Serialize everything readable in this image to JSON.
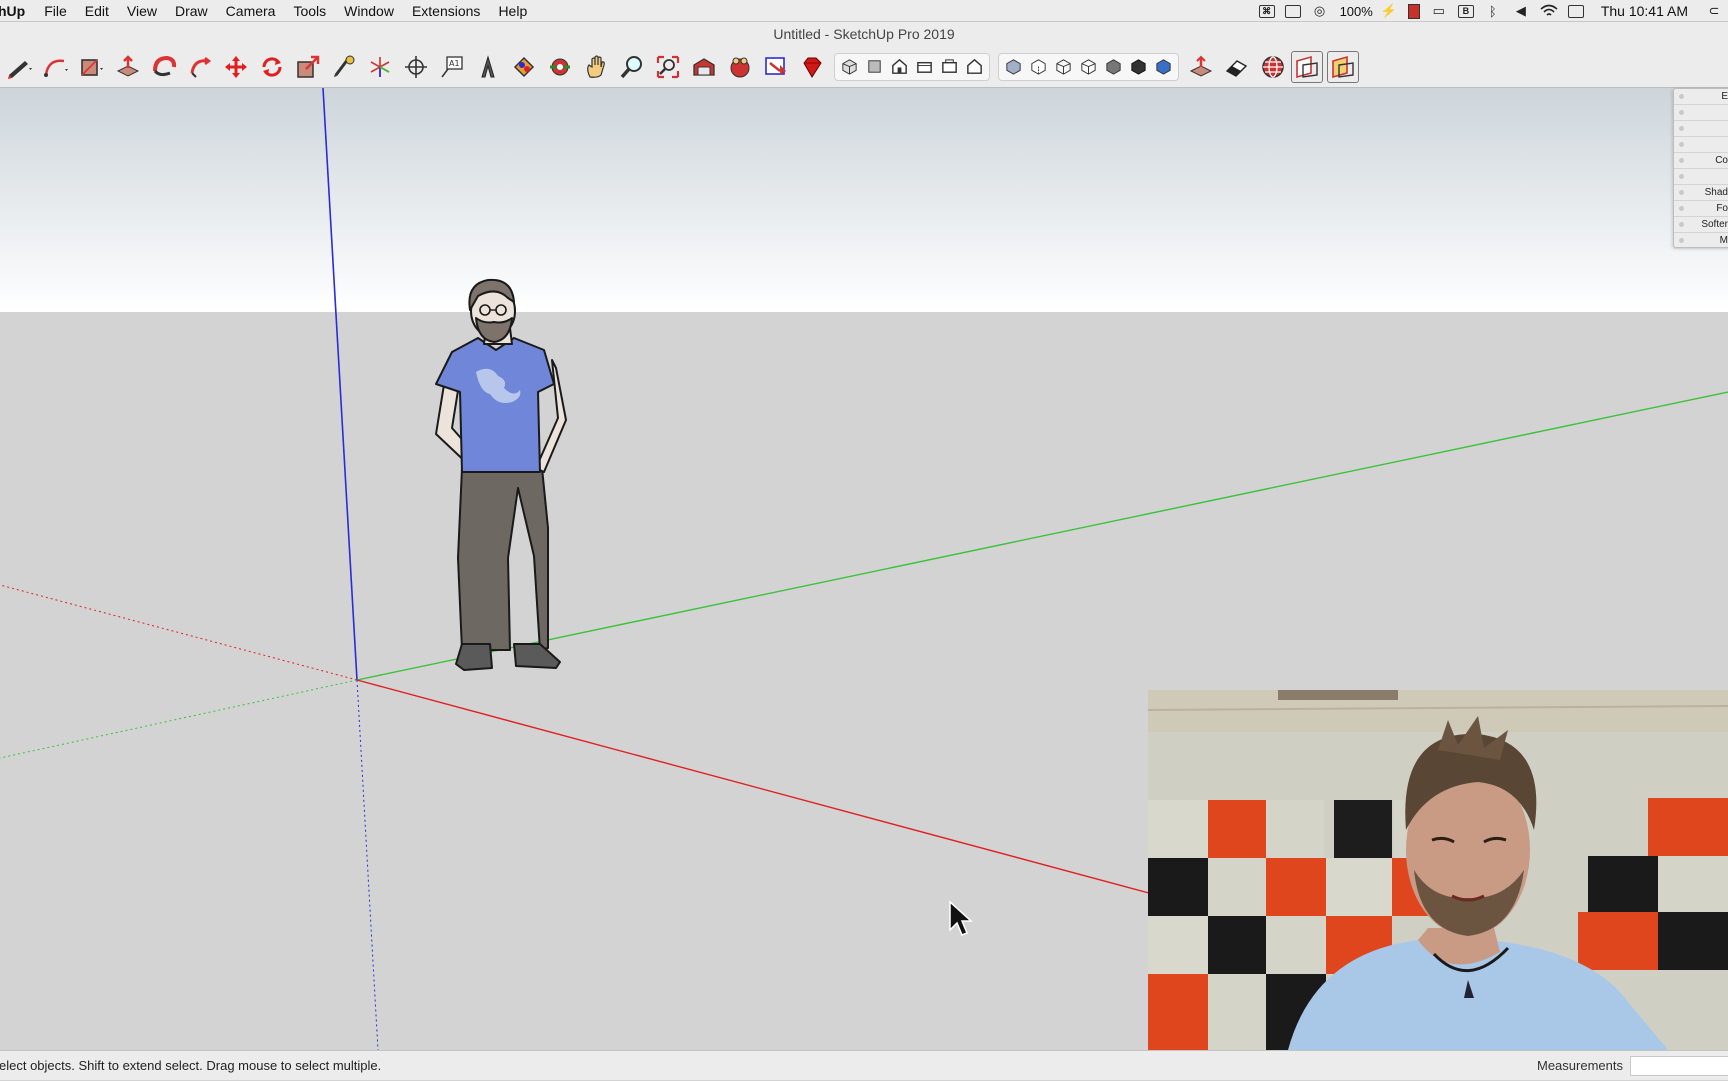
{
  "menubar": {
    "app_name": "hUp",
    "menus": [
      "File",
      "Edit",
      "View",
      "Draw",
      "Camera",
      "Tools",
      "Window",
      "Extensions",
      "Help"
    ],
    "battery": "100%",
    "clock": "Thu 10:41 AM"
  },
  "window": {
    "title": "Untitled - SketchUp Pro 2019"
  },
  "toolbar": {
    "tools": [
      "pencil-icon",
      "arc-icon",
      "shape-icon",
      "eraser-icon",
      "paint-bucket-icon",
      "orbit-icon",
      "move-icon",
      "rotate-icon",
      "scale-icon",
      "tape-measure-icon",
      "axes-icon",
      "section-plane-icon",
      "text-icon",
      "3d-text-icon",
      "paint-icon",
      "follow-me-icon",
      "pan-icon",
      "zoom-icon",
      "zoom-extents-icon",
      "warehouse-icon",
      "extension-warehouse-icon",
      "layout-icon",
      "ruby-icon"
    ],
    "view_buttons": [
      "iso-view-icon",
      "top-view-icon",
      "front-view-icon",
      "right-view-icon",
      "back-view-icon",
      "left-view-icon"
    ],
    "style_buttons": [
      "xray-icon",
      "back-edges-icon",
      "wireframe-icon",
      "hidden-line-icon",
      "shaded-icon",
      "shaded-textures-icon",
      "monochrome-icon"
    ],
    "extra": [
      "sandbox-icon",
      "eraser-soft-icon",
      "geo-location-icon",
      "section-display-icon",
      "section-cut-icon"
    ]
  },
  "tray": {
    "rows": [
      "E",
      "",
      "",
      "",
      "Co",
      "",
      "Shad",
      "Fo",
      "Softer",
      "M"
    ]
  },
  "status": {
    "hint": "elect objects. Shift to extend select. Drag mouse to select multiple.",
    "measurements_label": "Measurements",
    "measurements_value": ""
  },
  "colors": {
    "blue_axis": "#2b2bd8",
    "red_axis": "#e02020",
    "green_axis": "#3ac23a",
    "shirt": "#6f86d9",
    "pants": "#6e6862"
  }
}
